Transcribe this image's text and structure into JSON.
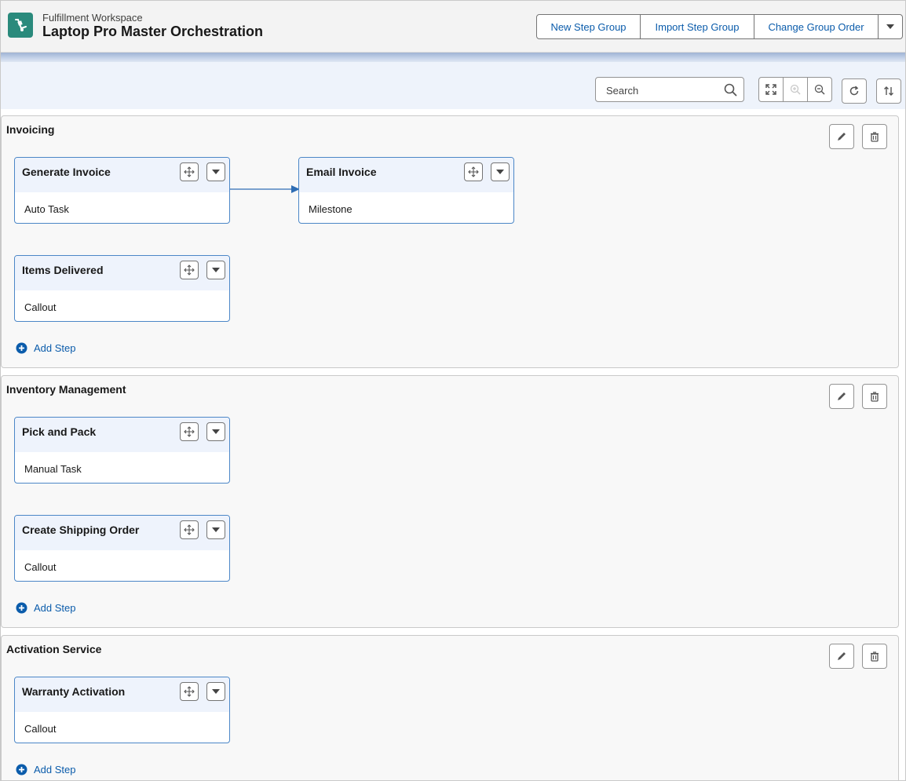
{
  "header": {
    "subtitle": "Fulfillment Workspace",
    "title": "Laptop Pro Master Orchestration",
    "actions": {
      "new_step_group": "New Step Group",
      "import_step_group": "Import Step Group",
      "change_group_order": "Change Group Order"
    }
  },
  "toolbar": {
    "search_placeholder": "Search"
  },
  "add_step_label": "Add Step",
  "sections": [
    {
      "title": "Invoicing",
      "steps": [
        {
          "title": "Generate Invoice",
          "type": "Auto Task"
        },
        {
          "title": "Email Invoice",
          "type": "Milestone"
        },
        {
          "title": "Items Delivered",
          "type": "Callout"
        }
      ]
    },
    {
      "title": "Inventory Management",
      "steps": [
        {
          "title": "Pick and Pack",
          "type": "Manual Task"
        },
        {
          "title": "Create Shipping Order",
          "type": "Callout"
        }
      ]
    },
    {
      "title": "Activation Service",
      "steps": [
        {
          "title": "Warranty Activation",
          "type": "Callout"
        }
      ]
    }
  ],
  "colors": {
    "brand_icon": "#2a8a7c",
    "link_blue": "#0b5cab",
    "card_border": "#4c87c7",
    "card_header": "#eef3fc"
  }
}
